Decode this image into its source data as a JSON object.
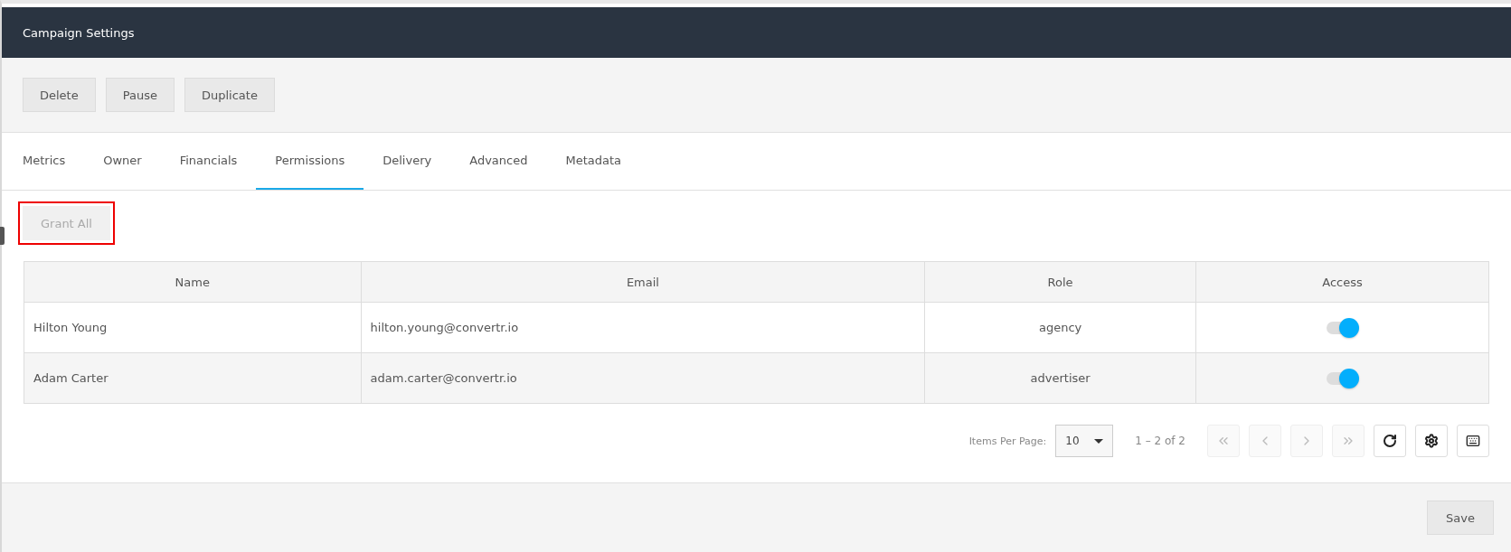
{
  "header": {
    "title": "Campaign Settings"
  },
  "actions": [
    {
      "label": "Delete"
    },
    {
      "label": "Pause"
    },
    {
      "label": "Duplicate"
    }
  ],
  "tabs": [
    {
      "label": "Metrics",
      "selected": false
    },
    {
      "label": "Owner",
      "selected": false
    },
    {
      "label": "Financials",
      "selected": false
    },
    {
      "label": "Permissions",
      "selected": true
    },
    {
      "label": "Delivery",
      "selected": false
    },
    {
      "label": "Advanced",
      "selected": false
    },
    {
      "label": "Metadata",
      "selected": false
    }
  ],
  "grant_all": {
    "label": "Grant All",
    "disabled": true,
    "highlighted": true
  },
  "table": {
    "columns": [
      "Name",
      "Email",
      "Role",
      "Access"
    ],
    "rows": [
      {
        "name": "Hilton Young",
        "email": "hilton.young@convertr.io",
        "role": "agency",
        "access": true
      },
      {
        "name": "Adam Carter",
        "email": "adam.carter@convertr.io",
        "role": "advertiser",
        "access": true
      }
    ]
  },
  "pager": {
    "items_per_page_label": "Items Per Page:",
    "items_per_page": "10",
    "range": "1 – 2 of 2",
    "nav": [
      {
        "kind": "first",
        "disabled": true
      },
      {
        "kind": "prev",
        "disabled": true
      },
      {
        "kind": "next",
        "disabled": true
      },
      {
        "kind": "last",
        "disabled": true
      },
      {
        "kind": "refresh",
        "disabled": false
      },
      {
        "kind": "settings",
        "disabled": false
      },
      {
        "kind": "keyboard",
        "disabled": false
      }
    ]
  },
  "footer": {
    "save": "Save"
  }
}
